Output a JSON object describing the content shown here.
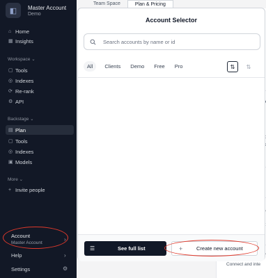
{
  "workspace": {
    "name": "Master Account",
    "sub": "Demo"
  },
  "sidebar": {
    "top_items": [
      {
        "label": "Home",
        "icon": "home-icon"
      },
      {
        "label": "Insights",
        "icon": "chart-icon"
      }
    ],
    "workspace_section": {
      "label": "Workspace",
      "items": [
        {
          "label": "Tools",
          "icon": "tools-icon"
        },
        {
          "label": "Indexes",
          "icon": "database-icon"
        },
        {
          "label": "Re-rank",
          "icon": "rerank-icon"
        },
        {
          "label": "API",
          "icon": "api-icon"
        }
      ]
    },
    "backstage_section": {
      "label": "Backstage",
      "items": [
        {
          "label": "Plan",
          "icon": "document-icon",
          "active": true
        },
        {
          "label": "Tools",
          "icon": "tools-icon"
        },
        {
          "label": "Indexes",
          "icon": "database-icon"
        },
        {
          "label": "Models",
          "icon": "model-icon"
        }
      ]
    },
    "more_section": {
      "label": "More",
      "items": [
        {
          "label": "Invite people",
          "icon": "plus-icon"
        }
      ]
    },
    "account": {
      "title": "Account",
      "sub": "Master Account"
    },
    "help": "Help",
    "settings": "Settings"
  },
  "background": {
    "tabs": [
      "Team Space",
      "Plan & Pricing"
    ],
    "fragments": [
      "r e",
      "we",
      "go",
      "ea",
      "ge",
      "nt",
      "ite",
      "Connect and inte"
    ]
  },
  "modal": {
    "title": "Account Selector",
    "search": {
      "placeholder": "Search accounts by name or id",
      "value": ""
    },
    "filters": [
      "All",
      "Clients",
      "Demo",
      "Free",
      "Pro"
    ],
    "active_filter": "All",
    "footer": {
      "full_list": "See full list",
      "create": "Create new account"
    }
  },
  "colors": {
    "sidebar_bg": "#121826",
    "accent_dark": "#111827",
    "annotation_red": "#e0392b"
  }
}
